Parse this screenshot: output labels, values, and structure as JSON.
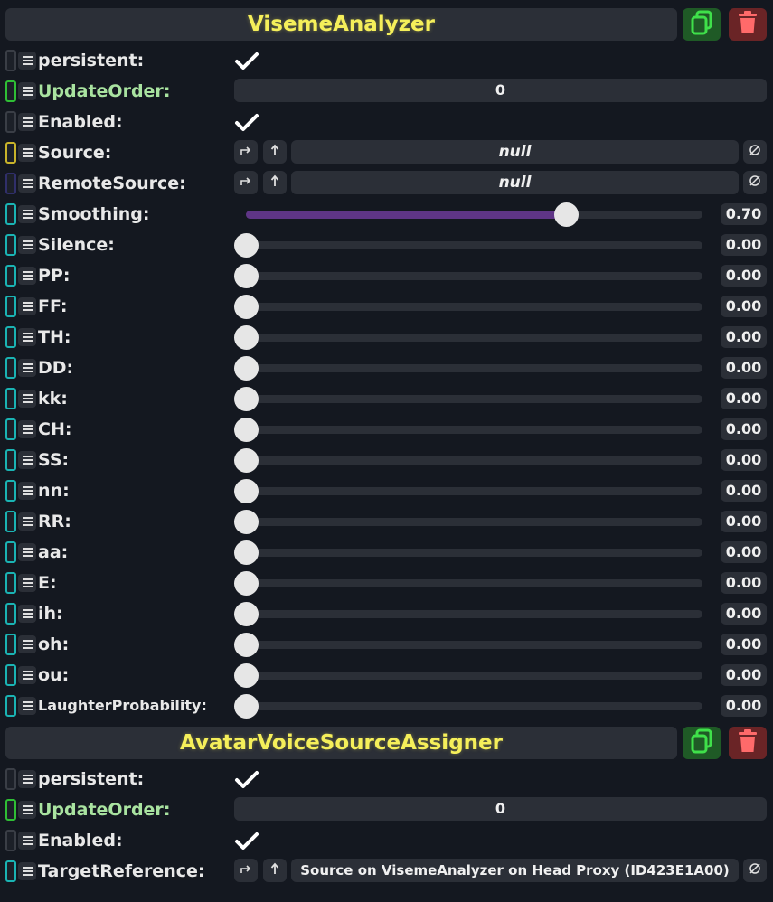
{
  "components": [
    {
      "title": "VisemeAnalyzer",
      "fields": [
        {
          "kind": "check",
          "label": "persistent",
          "drive": "black",
          "checked": true
        },
        {
          "kind": "number",
          "label": "UpdateOrder",
          "drive": "green",
          "value": "0",
          "label_color": "green"
        },
        {
          "kind": "check",
          "label": "Enabled",
          "drive": "black",
          "checked": true
        },
        {
          "kind": "ref",
          "label": "Source",
          "drive": "yellow",
          "value": "null",
          "italic": true
        },
        {
          "kind": "ref",
          "label": "RemoteSource",
          "drive": "purple",
          "value": "null",
          "italic": true
        },
        {
          "kind": "slider",
          "label": "Smoothing",
          "drive": "teal",
          "value": 0.7,
          "display": "0.70"
        },
        {
          "kind": "slider",
          "label": "Silence",
          "drive": "teal",
          "value": 0,
          "display": "0.00"
        },
        {
          "kind": "slider",
          "label": "PP",
          "drive": "teal",
          "value": 0,
          "display": "0.00"
        },
        {
          "kind": "slider",
          "label": "FF",
          "drive": "teal",
          "value": 0,
          "display": "0.00"
        },
        {
          "kind": "slider",
          "label": "TH",
          "drive": "teal",
          "value": 0,
          "display": "0.00"
        },
        {
          "kind": "slider",
          "label": "DD",
          "drive": "teal",
          "value": 0,
          "display": "0.00"
        },
        {
          "kind": "slider",
          "label": "kk",
          "drive": "teal",
          "value": 0,
          "display": "0.00"
        },
        {
          "kind": "slider",
          "label": "CH",
          "drive": "teal",
          "value": 0,
          "display": "0.00"
        },
        {
          "kind": "slider",
          "label": "SS",
          "drive": "teal",
          "value": 0,
          "display": "0.00"
        },
        {
          "kind": "slider",
          "label": "nn",
          "drive": "teal",
          "value": 0,
          "display": "0.00"
        },
        {
          "kind": "slider",
          "label": "RR",
          "drive": "teal",
          "value": 0,
          "display": "0.00"
        },
        {
          "kind": "slider",
          "label": "aa",
          "drive": "teal",
          "value": 0,
          "display": "0.00"
        },
        {
          "kind": "slider",
          "label": "E",
          "drive": "teal",
          "value": 0,
          "display": "0.00"
        },
        {
          "kind": "slider",
          "label": "ih",
          "drive": "teal",
          "value": 0,
          "display": "0.00"
        },
        {
          "kind": "slider",
          "label": "oh",
          "drive": "teal",
          "value": 0,
          "display": "0.00"
        },
        {
          "kind": "slider",
          "label": "ou",
          "drive": "teal",
          "value": 0,
          "display": "0.00"
        },
        {
          "kind": "slider",
          "label": "LaughterProbability",
          "drive": "teal",
          "value": 0,
          "display": "0.00",
          "small": true
        }
      ]
    },
    {
      "title": "AvatarVoiceSourceAssigner",
      "fields": [
        {
          "kind": "check",
          "label": "persistent",
          "drive": "black",
          "checked": true
        },
        {
          "kind": "number",
          "label": "UpdateOrder",
          "drive": "green",
          "value": "0",
          "label_color": "green"
        },
        {
          "kind": "check",
          "label": "Enabled",
          "drive": "black",
          "checked": true
        },
        {
          "kind": "ref",
          "label": "TargetReference",
          "drive": "teal",
          "value": "Source on VisemeAnalyzer on Head Proxy (ID423E1A00)",
          "italic": false
        }
      ]
    }
  ],
  "icons": {
    "duplicate": "duplicate-icon",
    "delete": "trash-icon",
    "check": "checkmark-icon",
    "menu": "hamburger-icon",
    "jump": "jump-to-icon",
    "parent": "up-arrow-icon",
    "null": "null-icon"
  },
  "colors": {
    "title": "#f5ef5a",
    "slider_fill": "#5f3586",
    "duplicate_btn": "#1f5a26",
    "delete_btn": "#6a2426"
  }
}
